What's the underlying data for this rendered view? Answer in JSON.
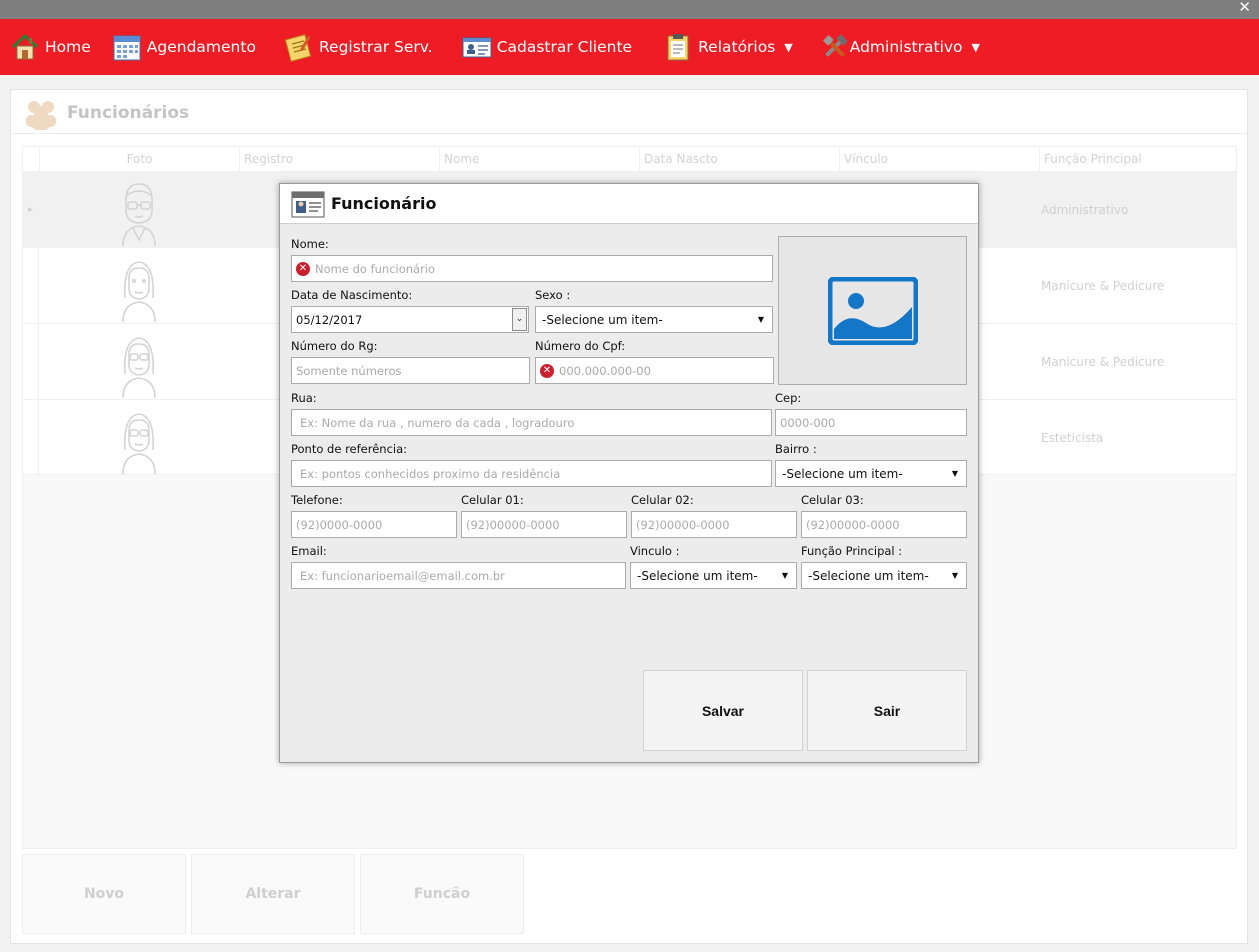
{
  "window": {
    "close_glyph": "✕"
  },
  "menu": [
    {
      "label": "Home",
      "icon": "house-icon",
      "has_caret": false
    },
    {
      "label": "Agendamento",
      "icon": "calendar-icon",
      "has_caret": false
    },
    {
      "label": "Registrar Serv.",
      "icon": "notepad-icon",
      "has_caret": false
    },
    {
      "label": "Cadastrar Cliente",
      "icon": "id-card-icon",
      "has_caret": false
    },
    {
      "label": "Relatórios",
      "icon": "clipboard-icon",
      "has_caret": true
    },
    {
      "label": "Administrativo",
      "icon": "tools-icon",
      "has_caret": true
    }
  ],
  "caret_glyph": "▼",
  "page": {
    "title": "Funcionários",
    "grid": {
      "columns": [
        "Foto",
        "Registro",
        "Nome",
        "Data Nascto",
        "Vínculo",
        "Função Principal"
      ],
      "rows": [
        {
          "func": "Administrativo",
          "avatar": "male-glasses-avatar",
          "selected": true
        },
        {
          "func": "Manicure & Pedicure",
          "avatar": "female-avatar",
          "selected": false
        },
        {
          "func": "Manicure & Pedicure",
          "avatar": "female-glasses-avatar",
          "selected": false
        },
        {
          "func": "Esteticista",
          "avatar": "female-glasses-avatar",
          "selected": false
        }
      ],
      "row_marker": "▸"
    },
    "buttons": {
      "novo": "Novo",
      "alterar": "Alterar",
      "funcao": "Funcão"
    }
  },
  "dialog": {
    "title": "Funcionário",
    "error_glyph": "✕",
    "nome": {
      "label": "Nome:",
      "placeholder": "Nome do funcionário"
    },
    "nascimento": {
      "label": "Data de Nascimento:",
      "value": "05/12/2017",
      "button_glyph": "⌄"
    },
    "sexo": {
      "label": "Sexo :",
      "value": "-Selecione um item-"
    },
    "rg": {
      "label": "Número do Rg:",
      "placeholder": "Somente números"
    },
    "cpf": {
      "label": "Número do Cpf:",
      "placeholder": "000.000.000-00"
    },
    "rua": {
      "label": "Rua:",
      "placeholder": "Ex: Nome da rua , numero da  cada , logradouro"
    },
    "cep": {
      "label": "Cep:",
      "placeholder": "0000-000"
    },
    "referencia": {
      "label": "Ponto de referência:",
      "placeholder": "Ex: pontos conhecidos proximo da residência"
    },
    "bairro": {
      "label": "Bairro :",
      "value": "-Selecione um item-"
    },
    "telefone": {
      "label": "Telefone:",
      "placeholder": "(92)0000-0000"
    },
    "celular1": {
      "label": "Celular 01:",
      "placeholder": "(92)00000-0000"
    },
    "celular2": {
      "label": "Celular 02:",
      "placeholder": "(92)00000-0000"
    },
    "celular3": {
      "label": "Celular 03:",
      "placeholder": "(92)00000-0000"
    },
    "email": {
      "label": "Email:",
      "placeholder": "Ex: funcionarioemail@email.com.br"
    },
    "vinculo": {
      "label": "Vinculo :",
      "value": "-Selecione um item-"
    },
    "funcao": {
      "label": "Função Principal :",
      "value": "-Selecione um item-"
    },
    "select_arrow": "▼",
    "salvar": "Salvar",
    "sair": "Sair"
  },
  "colors": {
    "menubar": "#ee1c25",
    "titlebar": "#7f7f7f",
    "photo_icon": "#1476c6",
    "error": "#c8202e"
  }
}
